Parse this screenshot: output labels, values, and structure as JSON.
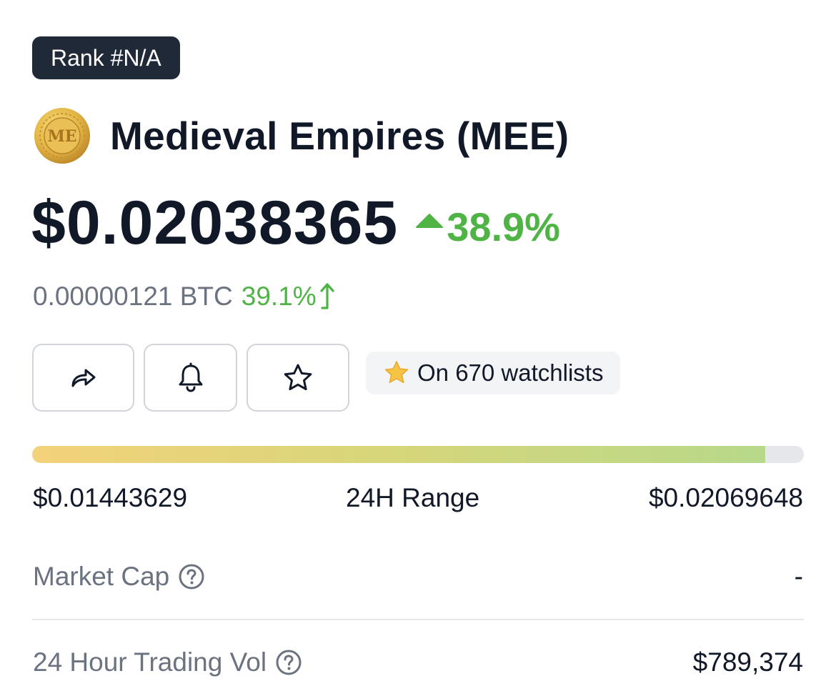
{
  "rank_badge": "Rank #N/A",
  "coin": {
    "name": "Medieval Empires (MEE)",
    "logo_text": "ME",
    "logo_icon": "medieval-empires-coin-logo"
  },
  "price": {
    "usd": "$0.02038365",
    "change_24h": "38.9%",
    "change_direction": "up",
    "btc": "0.00000121 BTC",
    "btc_change": "39.1%"
  },
  "actions": {
    "share_icon": "share-arrow-icon",
    "alert_icon": "bell-icon",
    "watchlist_icon": "star-outline-icon"
  },
  "watchlist": {
    "label": "On 670 watchlists"
  },
  "range_24h": {
    "low": "$0.01443629",
    "label": "24H Range",
    "high": "$0.02069648",
    "current_fraction": 0.95
  },
  "stats": {
    "market_cap": {
      "label": "Market Cap",
      "value": "-"
    },
    "trading_vol": {
      "label": "24 Hour Trading Vol",
      "value": "$789,374"
    }
  },
  "colors": {
    "positive": "#4fb346",
    "badge_bg": "#1f2937",
    "muted_text": "#6b7280",
    "range_start": "#f3d27a",
    "range_end": "#b7d98a"
  }
}
